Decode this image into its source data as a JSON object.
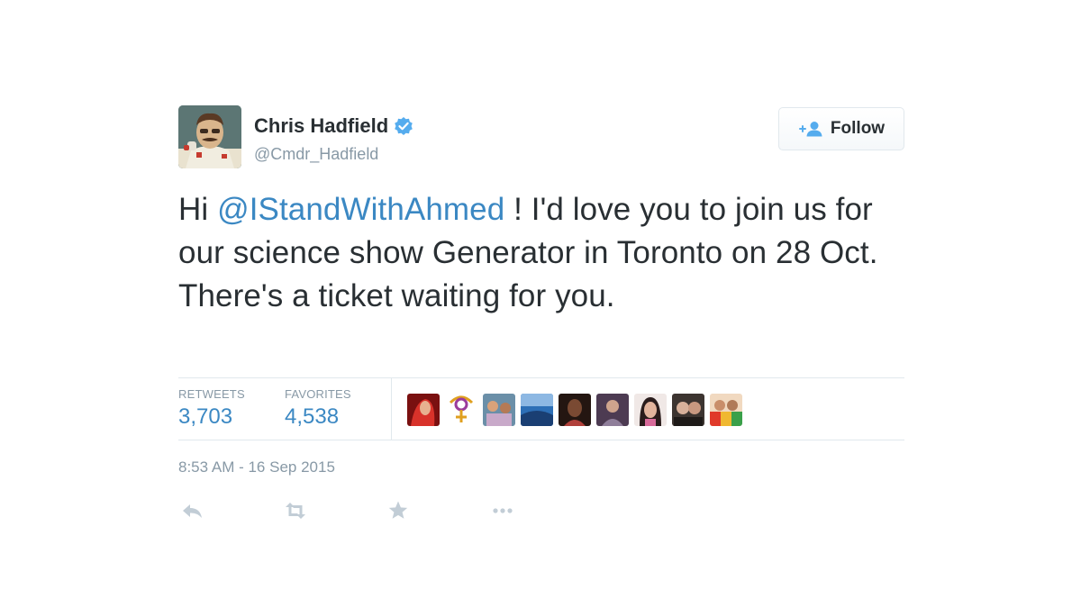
{
  "tweet": {
    "author": {
      "name": "Chris Hadfield",
      "handle": "@Cmdr_Hadfield",
      "verified": true,
      "avatar_icon": "astronaut-avatar"
    },
    "follow_button": {
      "label": "Follow",
      "icon": "add-user-icon"
    },
    "text": {
      "prefix": "Hi ",
      "mention": "@IStandWithAhmed",
      "suffix": " ! I'd love you to join us for our science show Generator in Toronto on 28 Oct. There's a ticket waiting for you."
    },
    "stats": {
      "retweets_label": "RETWEETS",
      "retweets_value": "3,703",
      "favorites_label": "FAVORITES",
      "favorites_value": "4,538"
    },
    "favoriter_avatars": [
      {
        "icon": "user-avatar-red"
      },
      {
        "icon": "user-avatar-symbol"
      },
      {
        "icon": "user-avatar-group"
      },
      {
        "icon": "user-avatar-landscape"
      },
      {
        "icon": "user-avatar-dark"
      },
      {
        "icon": "user-avatar-person"
      },
      {
        "icon": "user-avatar-portrait"
      },
      {
        "icon": "user-avatar-couple"
      },
      {
        "icon": "user-avatar-colorful"
      }
    ],
    "timestamp": "8:53 AM - 16 Sep 2015",
    "actions": [
      {
        "name": "reply",
        "icon": "reply-icon"
      },
      {
        "name": "retweet",
        "icon": "retweet-icon"
      },
      {
        "name": "favorite",
        "icon": "star-icon"
      },
      {
        "name": "more",
        "icon": "more-icon"
      }
    ],
    "colors": {
      "link": "#3b88c3",
      "text": "#292f33",
      "muted": "#8899a6",
      "border": "#e1e8ed",
      "verified": "#55acee"
    }
  }
}
